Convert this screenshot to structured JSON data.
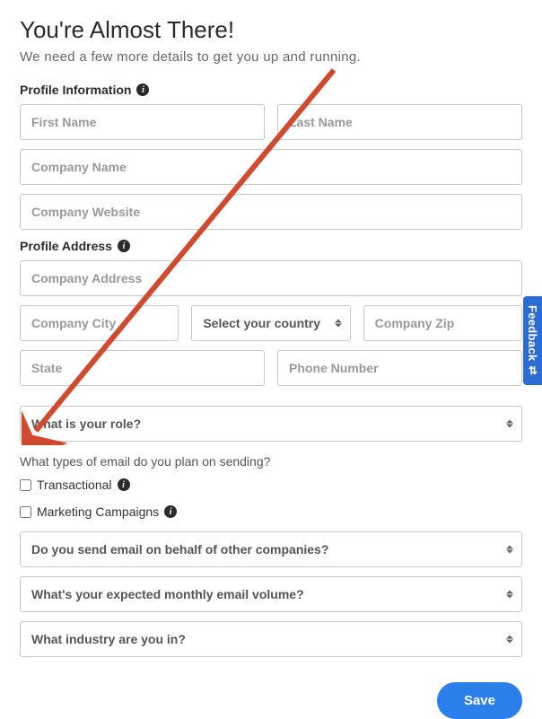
{
  "header": {
    "title": "You're Almost There!",
    "subtitle": "We need a few more details to get you up and running."
  },
  "profile_info": {
    "label": "Profile Information",
    "first_name_ph": "First Name",
    "last_name_ph": "Last Name",
    "company_name_ph": "Company Name",
    "company_website_ph": "Company Website"
  },
  "profile_address": {
    "label": "Profile Address",
    "company_address_ph": "Company Address",
    "company_city_ph": "Company City",
    "country_selected": "Select your country",
    "zip_ph": "Company Zip",
    "state_ph": "State",
    "phone_ph": "Phone Number"
  },
  "role_select": {
    "selected": "What is your role?"
  },
  "email_types": {
    "question": "What types of email do you plan on sending?",
    "transactional_label": "Transactional",
    "marketing_label": "Marketing Campaigns"
  },
  "selects": {
    "behalf": "Do you send email on behalf of other companies?",
    "volume": "What's your expected monthly email volume?",
    "industry": "What industry are you in?"
  },
  "save_label": "Save",
  "feedback": {
    "label": "Feedback"
  }
}
